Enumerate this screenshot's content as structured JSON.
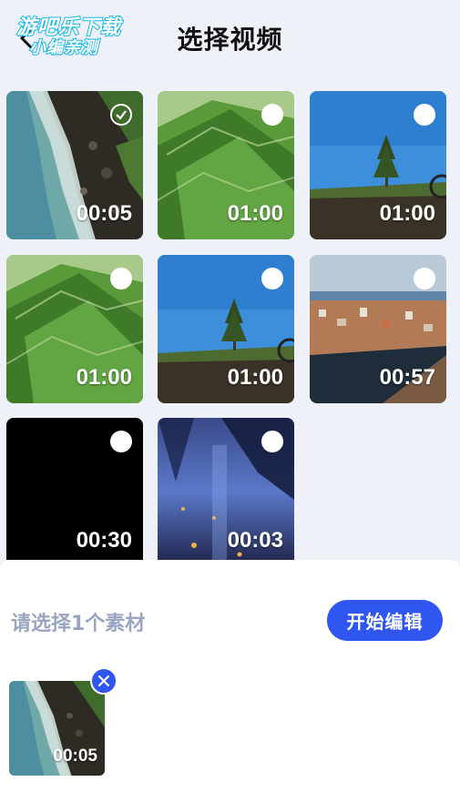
{
  "header": {
    "title": "选择视频",
    "watermark_line1": "游吧乐下载",
    "watermark_line2": "小编亲测"
  },
  "videos": [
    {
      "duration": "00:05",
      "selected": true,
      "thumb": "coastline"
    },
    {
      "duration": "01:00",
      "selected": false,
      "thumb": "green-hill"
    },
    {
      "duration": "01:00",
      "selected": false,
      "thumb": "tree-sky"
    },
    {
      "duration": "01:00",
      "selected": false,
      "thumb": "green-hill"
    },
    {
      "duration": "01:00",
      "selected": false,
      "thumb": "tree-sky"
    },
    {
      "duration": "00:57",
      "selected": false,
      "thumb": "harbor-town"
    },
    {
      "duration": "00:30",
      "selected": false,
      "thumb": "black"
    },
    {
      "duration": "00:03",
      "selected": false,
      "thumb": "blue-forest"
    }
  ],
  "bottom_panel": {
    "hint": "请选择1个素材",
    "start_button": "开始编辑",
    "selected": [
      {
        "duration": "00:05",
        "thumb": "coastline"
      }
    ]
  },
  "colors": {
    "accent": "#2f56f0",
    "hint_text": "#9aa6bf",
    "background": "#eef1f7",
    "watermark_stroke": "#17b8e6"
  },
  "icons": {
    "back": "back-arrow-icon",
    "check": "checkmark-icon",
    "unselected": "radio-circle-icon",
    "remove": "close-icon"
  }
}
